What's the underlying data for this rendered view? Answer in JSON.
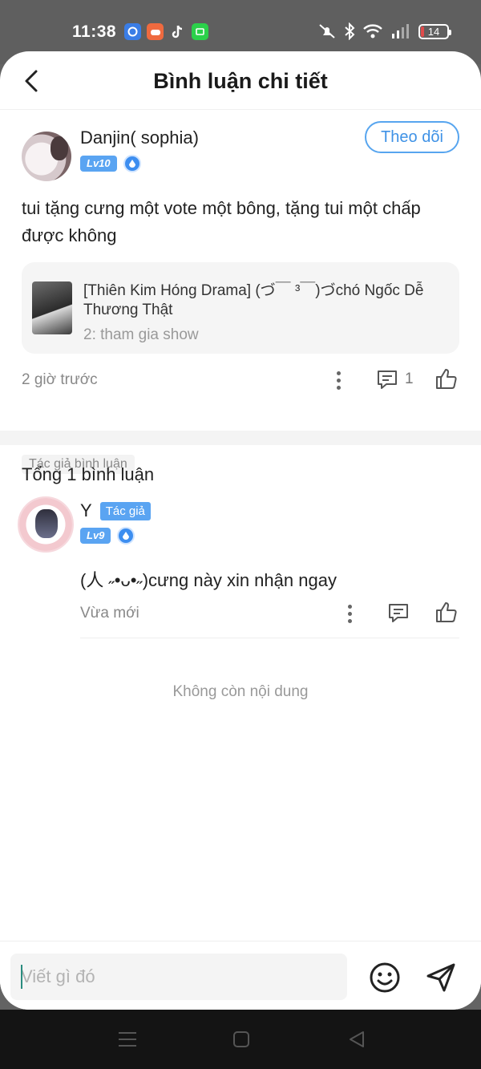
{
  "status_bar": {
    "time": "11:38",
    "battery": "14",
    "battery_level": 0.14,
    "app_icons": [
      "browser-icon",
      "game-icon",
      "tiktok-icon",
      "chat-icon"
    ],
    "system_icons": [
      "mute-icon",
      "bluetooth-icon",
      "wifi-icon",
      "signal-icon"
    ]
  },
  "header": {
    "title": "Bình luận chi tiết"
  },
  "main_comment": {
    "user_name": "Danjin( sophia)",
    "level": "Lv10",
    "follow_label": "Theo dõi",
    "text": "tui tặng cưng một vote một bông, tặng tui một chấp được không",
    "quote": {
      "title": "[Thiên Kim Hóng Drama] (づ￣ ³￣)づchó Ngốc Dễ Thương Thật",
      "subtitle": "2: tham gia show"
    },
    "time": "2 giờ trước",
    "reply_count": "1",
    "author_tag": "Tác giả bình luận"
  },
  "replies_section": {
    "total_label": "Tổng 1 bình luận",
    "end_text": "Không còn nội dung"
  },
  "reply": {
    "user_name": "Y",
    "author_badge": "Tác giả",
    "level": "Lv9",
    "text": "(人 ˶•ᴗ•˶)cưng này xin nhận ngay",
    "time": "Vừa mới"
  },
  "input_bar": {
    "placeholder": "Viết gì đó"
  },
  "colors": {
    "accent": "#57a5ef",
    "badge": "#5aa4f2",
    "status_bar": "#5f5f5f",
    "nav_bar": "#141414"
  }
}
